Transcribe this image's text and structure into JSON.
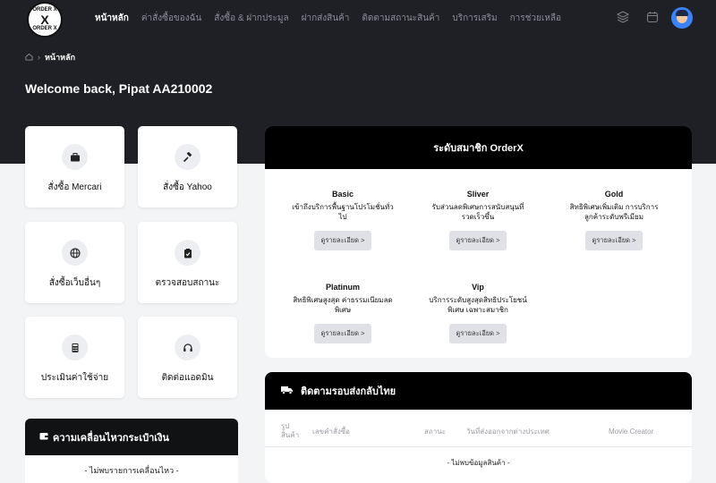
{
  "logo": {
    "top": "ORDER X",
    "mark": "X",
    "bottom": "ORDER X"
  },
  "nav": {
    "links": [
      "หน้าหลัก",
      "ค่าสั่งซื้อของฉัน",
      "สั่งซื้อ & ฝากประมูล",
      "ฝากส่งสินค้า",
      "ติดตามสถานะสินค้า",
      "บริการเสริม",
      "การช่วยเหลือ"
    ],
    "active": 0
  },
  "breadcrumb": {
    "current": "หน้าหลัก"
  },
  "welcome": "Welcome back, Pipat AA210002",
  "tiles": [
    {
      "label": "สั่งซื้อ Mercari",
      "icon": "briefcase-icon"
    },
    {
      "label": "สั่งซื้อ Yahoo",
      "icon": "gavel-icon"
    },
    {
      "label": "สั่งซื้อเว็บอื่นๆ",
      "icon": "globe-icon"
    },
    {
      "label": "ตรวจสอบสถานะ",
      "icon": "clipboard-check-icon"
    },
    {
      "label": "ประเมินค่าใช้จ่าย",
      "icon": "calculator-icon"
    },
    {
      "label": "ติดต่อแอดมิน",
      "icon": "headset-icon"
    }
  ],
  "wallet": {
    "title": "ความเคลื่อนไหวกระเป๋าเงิน",
    "empty": "- ไม่พบรายการเคลื่อนไหว -"
  },
  "membership": {
    "title": "ระดับสมาชิก OrderX",
    "details_label": "ดูรายละเอียด >",
    "tiers": [
      {
        "name": "Basic",
        "desc1": "เข้าถึงบริการพื้นฐานโปรโมชั่นทั่ว",
        "desc2": "ไป"
      },
      {
        "name": "Sliver",
        "desc1": "รับส่วนลดพิเศษการสนับสนุนที่",
        "desc2": "รวดเร็วขึ้น"
      },
      {
        "name": "Gold",
        "desc1": "สิทธิพิเศษเพิ่มเติม การบริการ",
        "desc2": "ลูกค้าระดับพรีเมียม"
      },
      {
        "name": "Platinum",
        "desc1": "สิทธิพิเศษสูงสุด ค่าธรรมเนียมลด",
        "desc2": "พิเศษ"
      },
      {
        "name": "Vip",
        "desc1": "บริการระดับสูงสุดสิทธิประโยชน์",
        "desc2": "พิเศษ เฉพาะสมาชิก"
      }
    ]
  },
  "tracking": {
    "title": "ติดตามรอบส่งกลับไทย",
    "columns": [
      "รูป\nสินค้า",
      "เลขคำสั่งซื้อ",
      "สถานะ",
      "วันที่ส่งออกจากต่างประเทศ",
      "Movie Creator"
    ],
    "empty": "- ไม่พบข้อมูลสินค้า -"
  }
}
